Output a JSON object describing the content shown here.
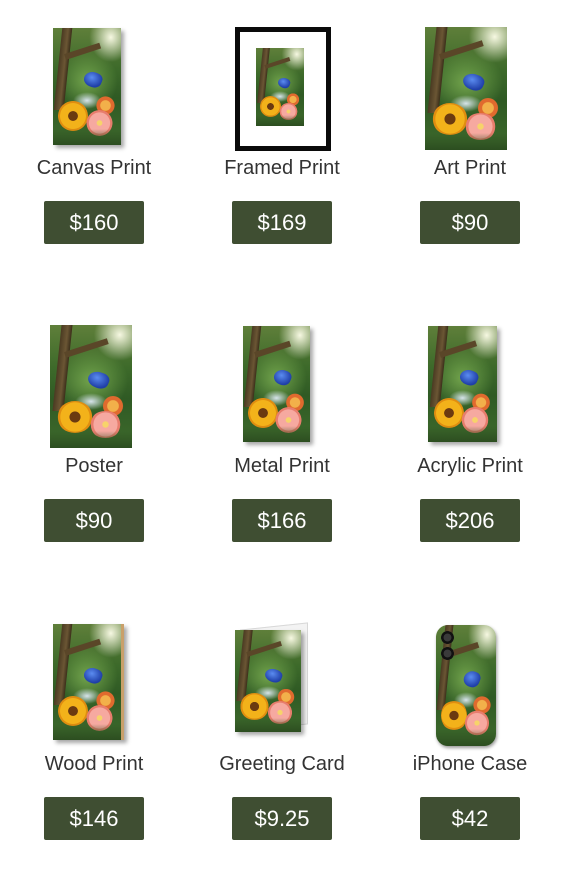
{
  "products": [
    {
      "label": "Canvas Print",
      "price": "$160"
    },
    {
      "label": "Framed Print",
      "price": "$169"
    },
    {
      "label": "Art Print",
      "price": "$90"
    },
    {
      "label": "Poster",
      "price": "$90"
    },
    {
      "label": "Metal Print",
      "price": "$166"
    },
    {
      "label": "Acrylic Print",
      "price": "$206"
    },
    {
      "label": "Wood Print",
      "price": "$146"
    },
    {
      "label": "Greeting Card",
      "price": "$9.25"
    },
    {
      "label": "iPhone Case",
      "price": "$42"
    }
  ],
  "colors": {
    "price_button_bg": "#3f4e32",
    "price_button_text": "#ffffff",
    "label_text": "#333333"
  }
}
